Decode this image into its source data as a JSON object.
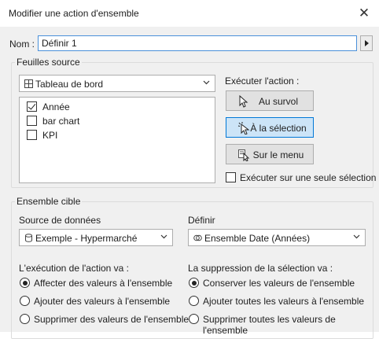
{
  "window": {
    "title": "Modifier une action d'ensemble",
    "close_glyph": "✕"
  },
  "name": {
    "label": "Nom :",
    "value": "Définir 1"
  },
  "source_sheets": {
    "group_label": "Feuilles source",
    "dashboard": "Tableau de bord",
    "items": [
      {
        "label": "Année",
        "checked": true
      },
      {
        "label": "bar chart",
        "checked": false
      },
      {
        "label": "KPI",
        "checked": false
      }
    ]
  },
  "execute": {
    "label": "Exécuter l'action :",
    "buttons": [
      {
        "label": "Au survol",
        "icon": "hover-cursor-icon",
        "selected": false
      },
      {
        "label": "À la sélection",
        "icon": "select-cursor-icon",
        "selected": true
      },
      {
        "label": "Sur le menu",
        "icon": "menu-cursor-icon",
        "selected": false
      }
    ],
    "single_select_label": "Exécuter sur une seule sélection",
    "single_select_checked": false
  },
  "target_set": {
    "group_label": "Ensemble cible",
    "datasource_label": "Source de données",
    "datasource_value": "Exemple - Hypermarché",
    "define_label": "Définir",
    "define_value": "Ensemble Date (Années)"
  },
  "run_action": {
    "label": "L'exécution de l'action va :",
    "options": [
      {
        "label": "Affecter des valeurs à l'ensemble",
        "checked": true
      },
      {
        "label": "Ajouter des valeurs à l'ensemble",
        "checked": false
      },
      {
        "label": "Supprimer des valeurs de l'ensemble",
        "checked": false
      }
    ]
  },
  "clear_selection": {
    "label": "La suppression de la sélection va :",
    "options": [
      {
        "label": "Conserver les valeurs de l'ensemble",
        "checked": true
      },
      {
        "label": "Ajouter toutes les valeurs à l'ensemble",
        "checked": false
      },
      {
        "label": "Supprimer toutes les valeurs de l'ensemble",
        "checked": false
      }
    ]
  },
  "colors": {
    "accent": "#0078d7",
    "selected_button": "#cce4f7",
    "dialog_bg": "#f0f0f0"
  }
}
